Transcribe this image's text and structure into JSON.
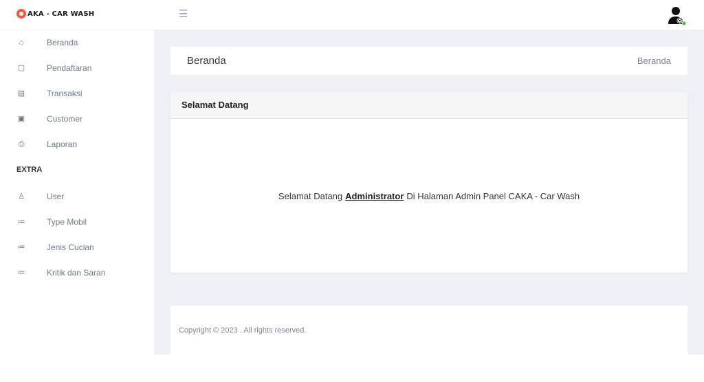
{
  "header": {
    "brand_text": "AKA - CAR WASH",
    "menu_icon": "hamburger-icon",
    "avatar_icon": "user-settings-icon"
  },
  "sidebar": {
    "items": [
      {
        "label": "Beranda",
        "icon": "home-icon"
      },
      {
        "label": "Pendaftaran",
        "icon": "clipboard-icon"
      },
      {
        "label": "Transaksi",
        "icon": "receipt-icon"
      },
      {
        "label": "Customer",
        "icon": "id-card-icon"
      },
      {
        "label": "Laporan",
        "icon": "printer-icon"
      }
    ],
    "section_heading": "EXTRA",
    "extra_items": [
      {
        "label": "User",
        "icon": "user-icon"
      },
      {
        "label": "Type Mobil",
        "icon": "list-icon"
      },
      {
        "label": "Jenis Cucian",
        "icon": "list-icon"
      },
      {
        "label": "Kritik dan Saran",
        "icon": "list-icon"
      }
    ]
  },
  "page": {
    "title": "Beranda",
    "breadcrumb": "Beranda"
  },
  "card": {
    "title": "Selamat Datang",
    "message_prefix": "Selamat Datang",
    "message_user": "Administrator",
    "message_suffix": "Di Halaman Admin Panel CAKA - Car Wash"
  },
  "footer": {
    "copyright": "Copyright © 2023 . All rights reserved."
  },
  "colors": {
    "brand": "#f05a3c",
    "content_bg": "#eef1f6",
    "status_online": "#3cc45a"
  }
}
